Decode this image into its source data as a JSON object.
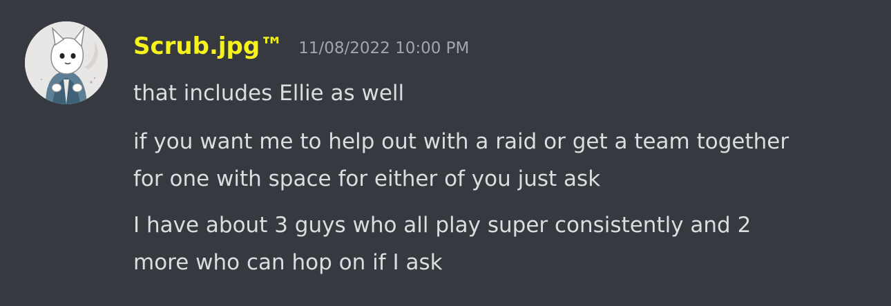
{
  "message": {
    "author": {
      "name": "Scrub.jpg™",
      "name_color": "#f5f21c",
      "avatar_icon": "white-cat-character-avatar-icon"
    },
    "timestamp": "11/08/2022 10:00 PM",
    "lines": [
      "that includes Ellie as well",
      "if you want me to help out with a raid or get a team together",
      "for one with space for either of you just ask",
      "I have about 3 guys who all play super consistently and 2",
      "more who can hop on if I ask"
    ]
  },
  "theme": {
    "background": "#36393f",
    "text": "#dcddde",
    "timestamp": "#a3a6aa"
  }
}
